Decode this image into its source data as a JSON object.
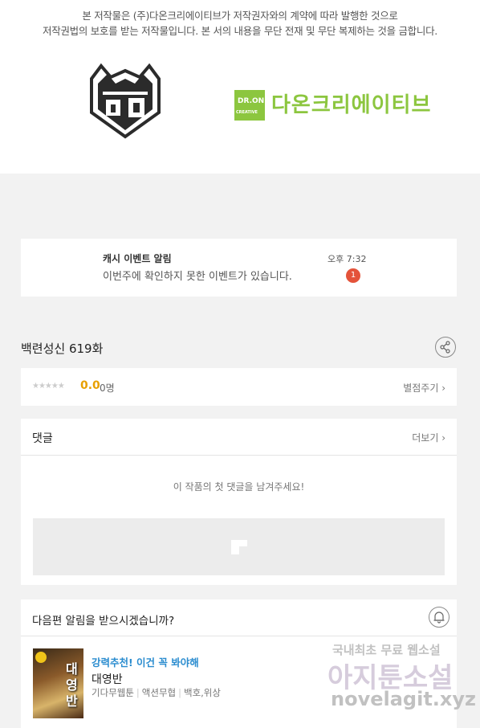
{
  "copyright": {
    "line1": "본 저작물은 (주)다온크리에이티브가 저작권자와의 계약에 따라 발행한 것으로",
    "line2": "저작권법의 보호를 받는 저작물입니다. 본 서의 내용을 무단 전재 및 무단 복제하는 것을 금합니다."
  },
  "publisher": {
    "logo_left_icon": "yeonjeon-crest-logo",
    "logo_right_box_top": "DR.ON",
    "logo_right_box_bottom": "CREATIVE",
    "logo_right_name": "다온크리에이티브",
    "accent_color": "#8cc63f"
  },
  "notification": {
    "title": "캐시 이벤트 알림",
    "message": "이번주에 확인하지 못한 이벤트가 있습니다.",
    "time": "오후 7:32",
    "badge": "1"
  },
  "episode": {
    "title": "백련성신 619화",
    "share_icon": "share-icon"
  },
  "rating": {
    "stars": "★★★★★",
    "score": "0.0",
    "count": "0명",
    "rate_button": "별점주기 ›"
  },
  "comments": {
    "header": "댓글",
    "more": "더보기 ›",
    "empty_message": "이 작품의 첫 댓글을 남겨주세요!"
  },
  "next_episode": {
    "prompt": "다음편 알림을 받으시겠습니까?",
    "bell_icon": "bell-icon"
  },
  "recommendation": {
    "headline": "강력추천! 이건 꼭 봐야해",
    "title": "대영반",
    "thumb_title": "대영반",
    "tags": [
      "기다무웹툰",
      "액션무협",
      "백호,위상"
    ]
  },
  "watermark": {
    "line1": "국내최초 무료 웹소설",
    "line2": "아지툰소설",
    "line3": "novelagit.xyz"
  }
}
